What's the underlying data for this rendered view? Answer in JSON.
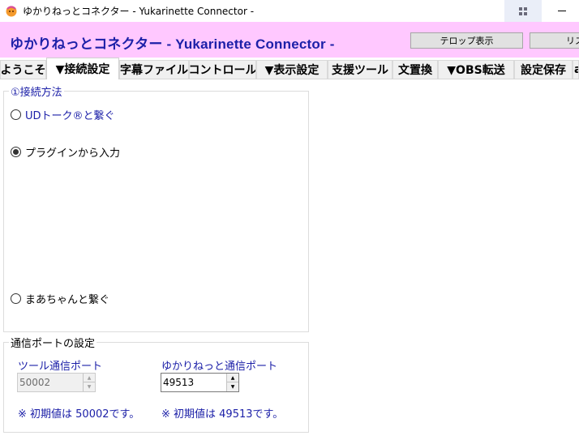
{
  "window": {
    "title": "ゆかりねっとコネクター - Yukarinette Connector -"
  },
  "header": {
    "title": "ゆかりねっとコネクター - Yukarinette Connector -",
    "telop_button": "テロップ表示",
    "list_button": "リス"
  },
  "tabs": [
    {
      "label": "ようこそ",
      "active": false
    },
    {
      "label": "▼接続設定",
      "active": true
    },
    {
      "label": "字幕ファイル",
      "active": false
    },
    {
      "label": "コントロール",
      "active": false
    },
    {
      "label": "▼表示設定",
      "active": false
    },
    {
      "label": "支援ツール",
      "active": false
    },
    {
      "label": "文置換",
      "active": false
    },
    {
      "label": "▼OBS転送",
      "active": false
    },
    {
      "label": "設定保存",
      "active": false
    },
    {
      "label": "a",
      "active": false
    }
  ],
  "connection_method": {
    "legend": "①接続方法",
    "options": [
      {
        "label": "UDトーク®と繋ぐ",
        "checked": false
      },
      {
        "label": "プラグインから入力",
        "checked": true
      },
      {
        "label": "まあちゃんと繋ぐ",
        "checked": false
      }
    ]
  },
  "port_settings": {
    "legend": "通信ポートの設定",
    "tool_port": {
      "label": "ツール通信ポート",
      "value": "50002",
      "note": "※ 初期値は 50002です。"
    },
    "yukarinette_port": {
      "label": "ゆかりねっと通信ポート",
      "value": "49513",
      "note": "※ 初期値は 49513です。"
    }
  },
  "colors": {
    "header_bg": "#ffc8ff",
    "accent_text": "#1c20a8"
  }
}
